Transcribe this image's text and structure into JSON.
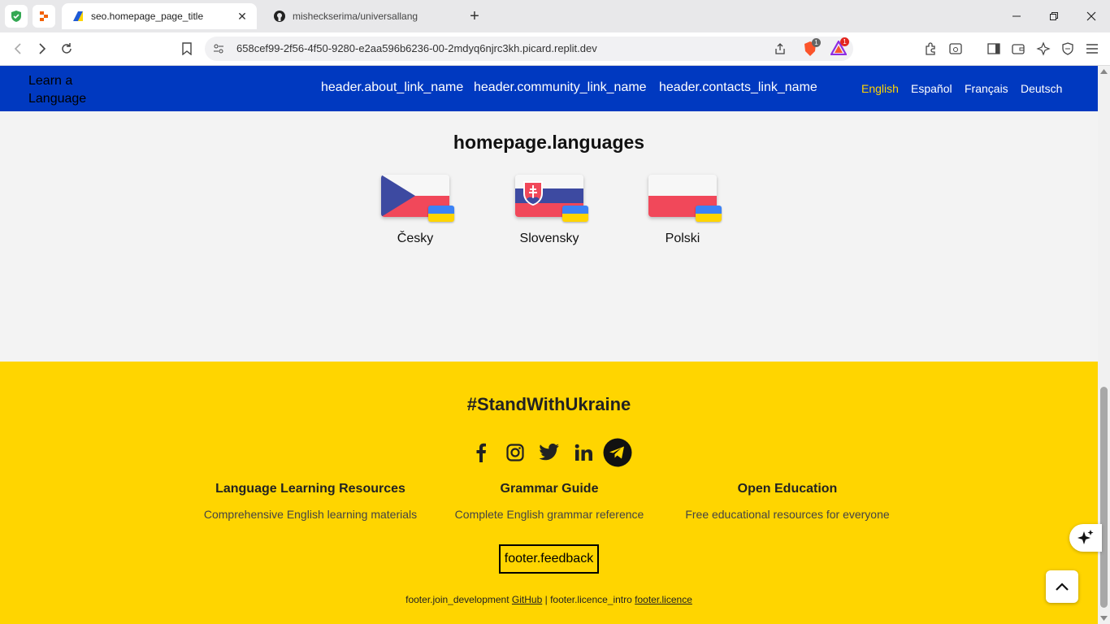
{
  "browser": {
    "tabs": [
      {
        "title": "seo.homepage_page_title",
        "active": true
      },
      {
        "title": "misheckserima/universallang",
        "active": false
      }
    ],
    "url": "658cef99-2f56-4f50-9280-e2aa596b6236-00-2mdyq6njrc3kh.picard.replit.dev",
    "badges": {
      "brave_shield": "1",
      "rewards": "1"
    }
  },
  "header": {
    "logo_alt": "Learn a Language",
    "nav": [
      {
        "label": "header.about_link_name"
      },
      {
        "label": "header.community_link_name"
      },
      {
        "label": "header.contacts_link_name"
      }
    ],
    "languages": [
      {
        "label": "English",
        "active": true
      },
      {
        "label": "Español",
        "active": false
      },
      {
        "label": "Français",
        "active": false
      },
      {
        "label": "Deutsch",
        "active": false
      }
    ]
  },
  "main": {
    "title": "homepage.languages",
    "items": [
      {
        "name": "Česky",
        "flag": "czech-flag"
      },
      {
        "name": "Slovensky",
        "flag": "slovak-flag"
      },
      {
        "name": "Polski",
        "flag": "polish-flag"
      }
    ]
  },
  "footer": {
    "hashtag": "#StandWithUkraine",
    "social": [
      "facebook-icon",
      "instagram-icon",
      "twitter-icon",
      "linkedin-icon",
      "telegram-icon"
    ],
    "columns": [
      {
        "title": "Language Learning Resources",
        "desc": "Comprehensive English learning materials"
      },
      {
        "title": "Grammar Guide",
        "desc": "Complete English grammar reference"
      },
      {
        "title": "Open Education",
        "desc": "Free educational resources for everyone"
      }
    ],
    "feedback": "footer.feedback",
    "join_development": "footer.join_development",
    "github": "GitHub",
    "separator": "|",
    "licence_intro": "footer.licence_intro",
    "licence": "footer.licence"
  },
  "colors": {
    "header_bg": "#0039c0",
    "footer_bg": "#ffd500",
    "active_lang": "#ffd500"
  }
}
